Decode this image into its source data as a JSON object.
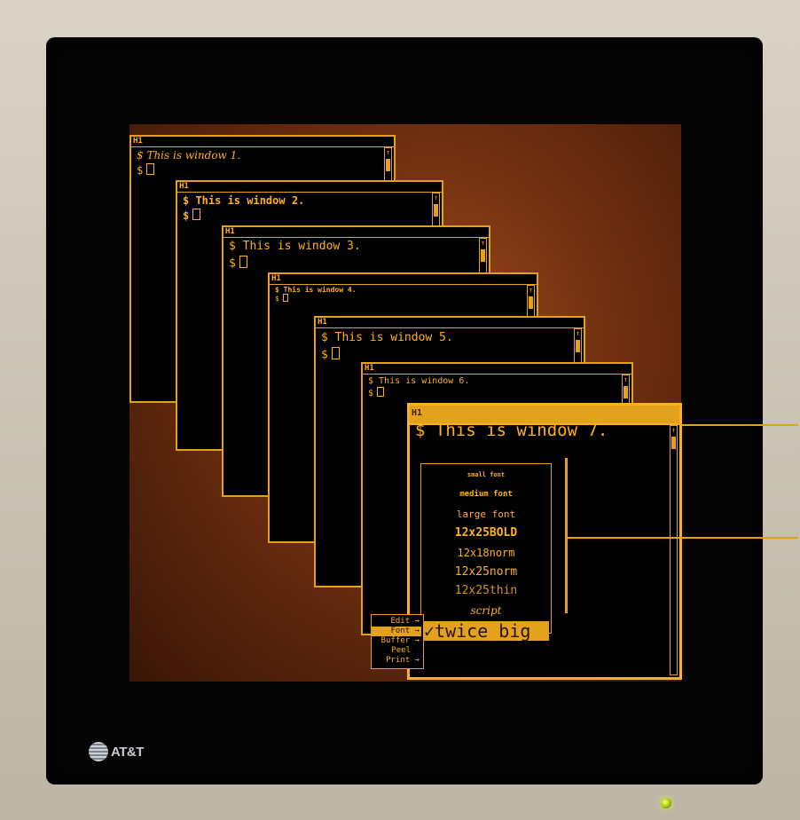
{
  "colors": {
    "amber": "#ffb020",
    "amber_border": "#e5a01a",
    "highlight": "#e2a21e",
    "background": "#000000"
  },
  "brand": {
    "name": "AT&T",
    "icon": "globe-logo-icon"
  },
  "windows": [
    {
      "tag": "H1",
      "line1": "$ This is window 1.",
      "prompt": "$"
    },
    {
      "tag": "H1",
      "line1": "$ This is window 2.",
      "prompt": "$"
    },
    {
      "tag": "H1",
      "line1": "$ This is window 3.",
      "prompt": "$"
    },
    {
      "tag": "H1",
      "line1": "$ This is window 4.",
      "prompt": "$"
    },
    {
      "tag": "H1",
      "line1": "$ This is window 5.",
      "prompt": "$"
    },
    {
      "tag": "H1",
      "line1": "$ This is window 6.",
      "prompt": "$"
    },
    {
      "tag": "H1",
      "line1": "$ This is window 7."
    }
  ],
  "context_menu": {
    "items": [
      "Edit",
      "Font",
      "Buffer",
      "Peel",
      "Print"
    ],
    "selected": "Font"
  },
  "font_submenu": {
    "items": [
      "small font",
      "medium font",
      "large font",
      "12x25BOLD",
      "12x18norm",
      "12x25norm",
      "12x25thin",
      "script"
    ],
    "selected": "✓twice_big"
  }
}
